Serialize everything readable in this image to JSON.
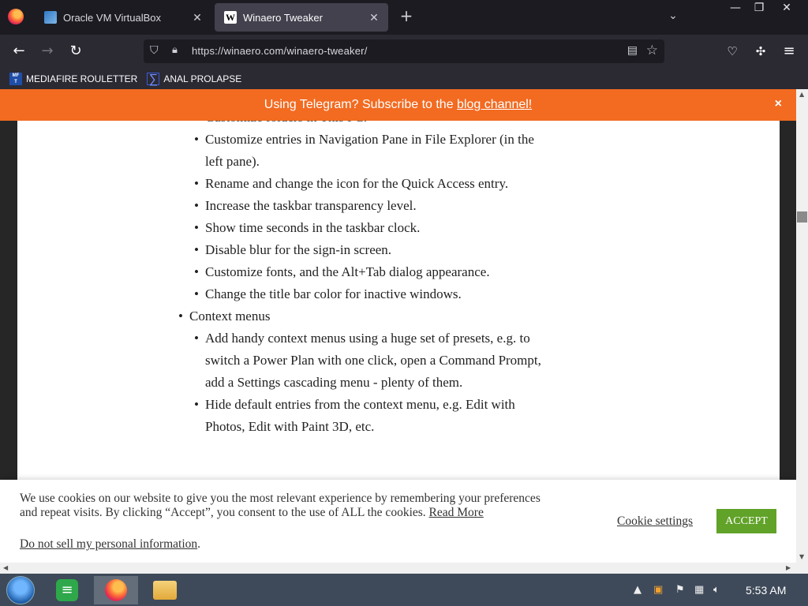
{
  "browser": {
    "tabs": [
      {
        "title": "Oracle VM VirtualBox",
        "active": false
      },
      {
        "title": "Winaero Tweaker",
        "active": true
      }
    ],
    "url": "https://winaero.com/winaero-tweaker/",
    "bookmarks": [
      "MEDIAFIRE ROULETTER",
      "ANAL PROLAPSE"
    ]
  },
  "banner": {
    "text": "Using Telegram? Subscribe to the ",
    "link": "blog channel!",
    "close": "×"
  },
  "article": {
    "cut_line": "Customize folders in This PC.",
    "sub_items_a": [
      "Customize entries in Navigation Pane in File Explorer (in the left pane).",
      "Rename and change the icon for the Quick Access entry.",
      "Increase the taskbar transparency level.",
      "Show time seconds in the taskbar clock.",
      "Disable blur for the sign-in screen.",
      "Customize fonts, and the Alt+Tab dialog appearance.",
      "Change the title bar color for inactive windows."
    ],
    "section": "Context menus",
    "sub_items_b": [
      "Add handy context menus using a huge set of presets, e.g. to switch a Power Plan with one click, open a Command Prompt, add a Settings cascading menu - plenty of them.",
      "Hide default entries from the context menu, e.g. Edit with Photos, Edit with Paint 3D, etc."
    ]
  },
  "cookie": {
    "text": "We use cookies on our website to give you the most relevant experience by remembering your preferences and repeat visits. By clicking “Accept”, you consent to the use of ALL the cookies. ",
    "read_more": "Read More",
    "do_not_sell": "Do not sell my personal information",
    "do_not_sell_suffix": ".",
    "settings": "Cookie settings",
    "accept": "ACCEPT"
  },
  "taskbar": {
    "time": "5:53 AM"
  },
  "icons": {
    "back": "arrow-left-icon",
    "forward": "arrow-right-icon",
    "reload": "reload-icon"
  },
  "colors": {
    "banner": "#f26b21",
    "accept": "#61a229"
  }
}
